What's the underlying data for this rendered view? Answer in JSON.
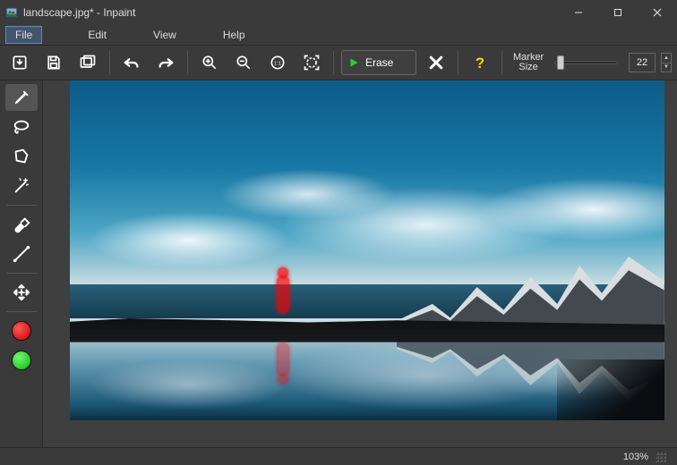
{
  "title": "landscape.jpg* - Inpaint",
  "menu": {
    "file": "File",
    "edit": "Edit",
    "view": "View",
    "help": "Help"
  },
  "toolbar": {
    "erase_label": "Erase",
    "marker_label_line1": "Marker",
    "marker_label_line2": "Size",
    "marker_size_value": "22"
  },
  "leftbar": {
    "tools": [
      "marker",
      "lasso",
      "polygon",
      "magic-wand",
      "eraser",
      "line",
      "move"
    ],
    "colors": [
      "red",
      "green"
    ]
  },
  "status": {
    "zoom": "103%"
  }
}
